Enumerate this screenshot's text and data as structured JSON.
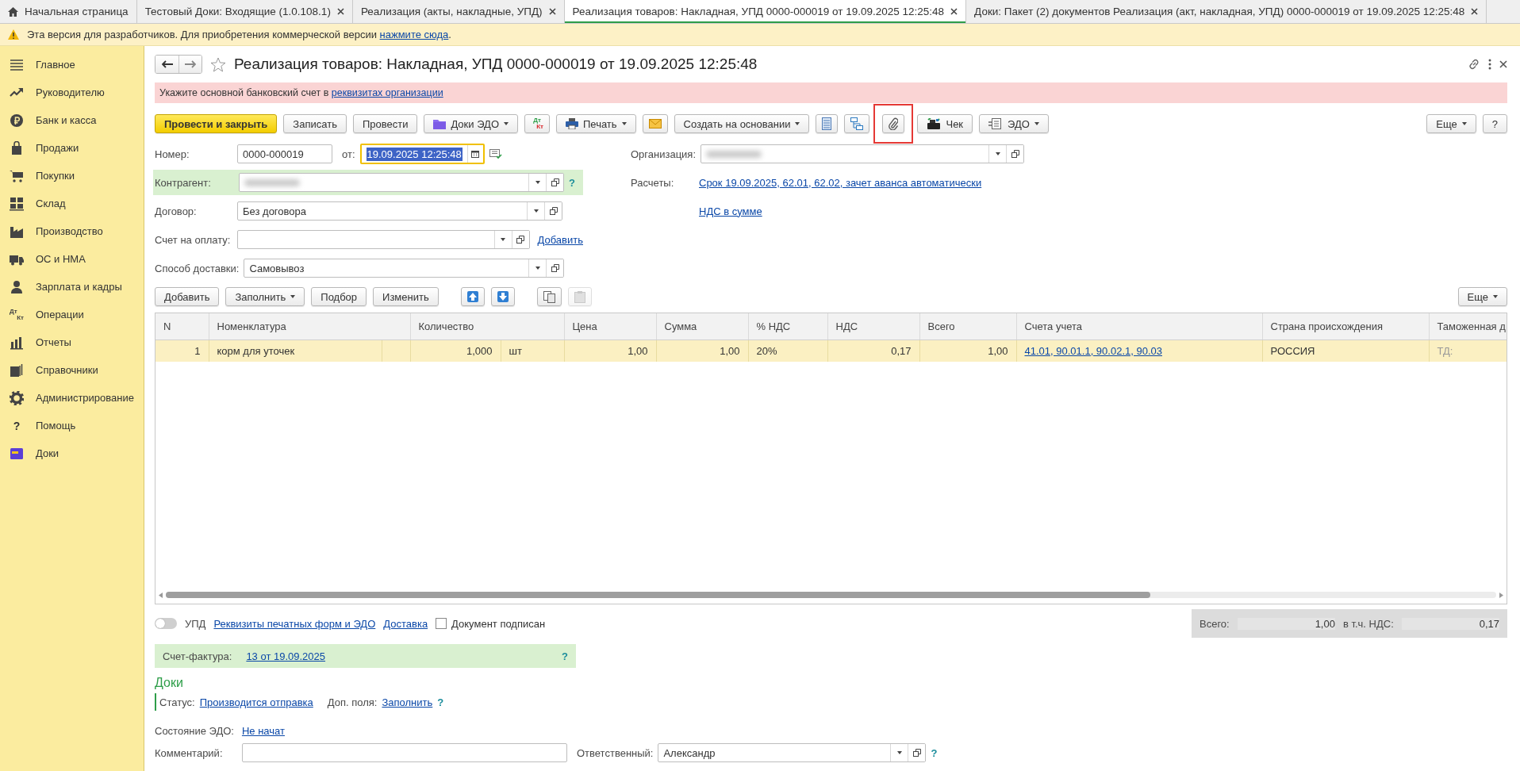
{
  "tabs": [
    {
      "kind": "home",
      "label": "Начальная страница",
      "selected": false
    },
    {
      "kind": "doc",
      "label": "Тестовый Доки: Входящие (1.0.108.1)",
      "selected": false
    },
    {
      "kind": "doc",
      "label": "Реализация (акты, накладные, УПД)",
      "selected": false
    },
    {
      "kind": "doc",
      "label": "Реализация товаров: Накладная, УПД 0000-000019 от 19.09.2025 12:25:48",
      "selected": true
    },
    {
      "kind": "doc",
      "label": "Доки:  Пакет (2) документов Реализация (акт, накладная, УПД) 0000-000019 от 19.09.2025 12:25:48",
      "selected": false
    }
  ],
  "banner": {
    "text": "Эта версия для разработчиков. Для приобретения коммерческой версии ",
    "link": "нажмите сюда",
    "tail": "."
  },
  "sidebar": {
    "items": [
      {
        "kind": "icon",
        "label": "Главное"
      },
      {
        "kind": "icon",
        "label": "Руководителю"
      },
      {
        "kind": "icon",
        "label": "Банк и касса"
      },
      {
        "kind": "icon",
        "label": "Продажи"
      },
      {
        "kind": "icon",
        "label": "Покупки"
      },
      {
        "kind": "icon",
        "label": "Склад"
      },
      {
        "kind": "icon",
        "label": "Производство"
      },
      {
        "kind": "icon",
        "label": "ОС и НМА"
      },
      {
        "kind": "icon",
        "label": "Зарплата и кадры"
      },
      {
        "kind": "dtkt",
        "label": "Операции",
        "icon_top": "Дт",
        "icon_bottom": "Кт"
      },
      {
        "kind": "icon",
        "label": "Отчеты"
      },
      {
        "kind": "icon",
        "label": "Справочники"
      },
      {
        "kind": "icon",
        "label": "Администрирование"
      },
      {
        "kind": "glyph",
        "label": "Помощь",
        "glyph": "?"
      },
      {
        "kind": "icon",
        "label": "Доки"
      }
    ]
  },
  "form": {
    "title": "Реализация товаров: Накладная, УПД 0000-000019 от 19.09.2025 12:25:48",
    "alert": {
      "text": "Укажите основной банковский счет в ",
      "link": "реквизитах организации"
    },
    "toolbar": [
      {
        "kind": "primary",
        "label": "Провести и закрыть",
        "menu": false,
        "highlighted": false
      },
      {
        "kind": "text",
        "label": "Записать",
        "menu": false,
        "highlighted": false
      },
      {
        "kind": "text",
        "label": "Провести",
        "menu": false,
        "highlighted": false
      },
      {
        "kind": "folder",
        "label": "Доки ЭДО",
        "menu": true,
        "highlighted": false
      },
      {
        "kind": "dtkt",
        "icon_top": "Дт",
        "icon_bottom": "Кт",
        "menu": false,
        "highlighted": false
      },
      {
        "kind": "print",
        "label": "Печать",
        "menu": true,
        "highlighted": false
      },
      {
        "kind": "mail",
        "menu": false,
        "highlighted": false
      },
      {
        "kind": "text",
        "label": "Создать на основании",
        "menu": true,
        "highlighted": false
      },
      {
        "kind": "list",
        "menu": false,
        "highlighted": false
      },
      {
        "kind": "structure",
        "menu": false,
        "highlighted": false
      },
      {
        "kind": "clip",
        "menu": false,
        "highlighted": true
      },
      {
        "kind": "cash",
        "label": "Чек",
        "menu": false,
        "highlighted": false
      },
      {
        "kind": "edo",
        "label": "ЭДО",
        "menu": true,
        "highlighted": false
      }
    ],
    "toolbar_right": [
      {
        "kind": "text",
        "label": "Еще",
        "menu": true,
        "highlighted": false
      },
      {
        "kind": "text",
        "label": "?",
        "menu": false,
        "highlighted": false
      }
    ],
    "number": {
      "label": "Номер:",
      "value": "0000-000019"
    },
    "date": {
      "label": "от:",
      "value": "19.09.2025 12:25:48",
      "focused": true
    },
    "organization": {
      "label": "Организация:",
      "redacted": true
    },
    "counterparty": {
      "label": "Контрагент:",
      "redacted": true,
      "help": "?"
    },
    "settlements": {
      "label": "Расчеты:",
      "link": "Срок 19.09.2025, 62.01, 62.02, зачет аванса автоматически"
    },
    "contract": {
      "label": "Договор:",
      "value": "Без договора"
    },
    "vat_link": "НДС в сумме",
    "payment_invoice": {
      "label": "Счет на оплату:",
      "link": "Добавить"
    },
    "delivery": {
      "label": "Способ доставки:",
      "value": "Самовывоз"
    },
    "table_toolbar": [
      {
        "kind": "text",
        "label": "Добавить",
        "menu": false,
        "disabled": false
      },
      {
        "kind": "text",
        "label": "Заполнить",
        "menu": true,
        "disabled": false
      },
      {
        "kind": "text",
        "label": "Подбор",
        "menu": false,
        "disabled": false
      },
      {
        "kind": "text",
        "label": "Изменить",
        "menu": false,
        "disabled": false
      },
      {
        "kind": "up",
        "menu": false,
        "disabled": false
      },
      {
        "kind": "down",
        "menu": false,
        "disabled": false
      },
      {
        "kind": "copy",
        "menu": false,
        "disabled": false
      },
      {
        "kind": "paste",
        "menu": false,
        "disabled": true
      }
    ],
    "table_more": {
      "label": "Еще"
    },
    "table": {
      "columns": [
        "N",
        "Номенклатура",
        "Количество",
        "Цена",
        "Сумма",
        "% НДС",
        "НДС",
        "Всего",
        "Счета учета",
        "Страна происхождения",
        "Таможенная д"
      ],
      "rows": [
        {
          "selected": true,
          "n": "1",
          "item": "корм для уточек",
          "quantity": "1,000",
          "unit": "шт",
          "price": "1,00",
          "sum": "1,00",
          "vat_rate": "20%",
          "vat": "0,17",
          "total": "1,00",
          "accounts": "41.01, 90.01.1, 90.02.1, 90.03",
          "country": "РОССИЯ",
          "customs": "ТД:"
        }
      ]
    },
    "upd": {
      "label": "УПД",
      "on": false
    },
    "footer_links": [
      "Реквизиты печатных форм и ЭДО",
      "Доставка"
    ],
    "signed": {
      "label": "Документ подписан",
      "checked": false
    },
    "totals": {
      "total_label": "Всего:",
      "total": "1,00",
      "vat_label": "в т.ч. НДС:",
      "vat": "0,17"
    },
    "invoice": {
      "label": "Счет-фактура:",
      "link": "13 от 19.09.2025",
      "help": "?"
    },
    "doki": {
      "title": "Доки",
      "status_label": "Статус:",
      "status_link": "Производится отправка",
      "extra_label": "Доп. поля:",
      "extra_link": "Заполнить",
      "help": "?"
    },
    "edo_state": {
      "label": "Состояние ЭДО:",
      "link": "Не начат"
    },
    "comment": {
      "label": "Комментарий:"
    },
    "responsible": {
      "label": "Ответственный:",
      "value": "Александр",
      "help": "?"
    }
  }
}
